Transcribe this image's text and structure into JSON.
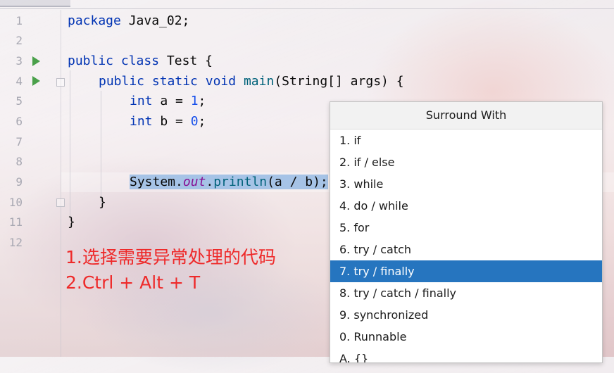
{
  "editor": {
    "line_numbers": [
      "1",
      "2",
      "3",
      "4",
      "5",
      "6",
      "7",
      "8",
      "9",
      "10",
      "11",
      "12"
    ],
    "lines": {
      "l1": {
        "kw": "package",
        "rest": " Java_02;"
      },
      "l3": {
        "kw1": "public",
        "kw2": "class",
        "rest": " Test {"
      },
      "l4": {
        "kw1": "public",
        "kw2": "static",
        "kw3": "void",
        "method": "main",
        "rest": "(String[] args) {"
      },
      "l5": {
        "kw": "int",
        "mid": " a = ",
        "num": "1",
        "end": ";"
      },
      "l6": {
        "kw": "int",
        "mid": " b = ",
        "num": "0",
        "end": ";"
      },
      "l9": {
        "cls": "System.",
        "field": "out",
        "dot": ".",
        "method": "println",
        "rest": "(a / b);"
      },
      "l10": {
        "text": "}"
      },
      "l11": {
        "text": "}"
      }
    },
    "run_icon": "run-gutter-icon",
    "fold_icon": "fold-marker-icon"
  },
  "annotation": {
    "line1": "1.选择需要异常处理的代码",
    "line2": "2.Ctrl + Alt + T",
    "color": "#ee2a2a"
  },
  "popup": {
    "title": "Surround With",
    "items": [
      "1. if",
      "2. if / else",
      "3. while",
      "4. do / while",
      "5. for",
      "6. try / catch",
      "7. try / finally",
      "8. try / catch / finally",
      "9. synchronized",
      "0. Runnable",
      "A. {}"
    ],
    "selected_index": 6,
    "selected_color": "#2675bf"
  }
}
